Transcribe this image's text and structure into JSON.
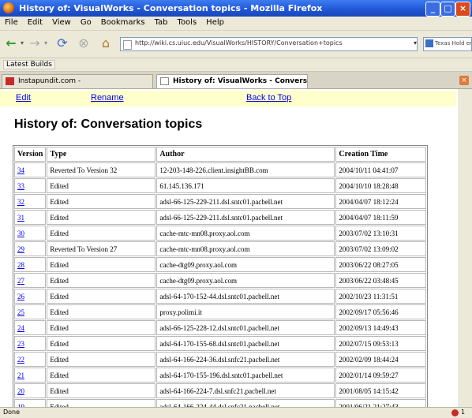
{
  "window": {
    "title": "History of: VisualWorks - Conversation topics - Mozilla Firefox",
    "minimize": "_",
    "maximize": "□",
    "close": "×"
  },
  "menu": [
    "File",
    "Edit",
    "View",
    "Go",
    "Bookmarks",
    "Tab",
    "Tools",
    "Help"
  ],
  "nav": {
    "back_icon": "←",
    "dropdown_icon": "▾",
    "forward_icon": "→",
    "reload_icon": "⟳",
    "stop_icon": "⊗",
    "home_icon": "⌂",
    "url": "http://wiki.cs.uiuc.edu/VisualWorks/HISTORY/Conversation+topics",
    "search_text": "Texas Hold em"
  },
  "bookmarks": {
    "latest_builds": "Latest Builds"
  },
  "tabs": [
    {
      "label": "Instapundit.com -"
    },
    {
      "label": "History of: VisualWorks - Conversatio..."
    }
  ],
  "tab_close": "×",
  "links": {
    "edit": "Edit",
    "rename": "Rename",
    "back_to_top": "Back to Top"
  },
  "page_title": "History of: Conversation topics",
  "table": {
    "headers": [
      "Version",
      "Type",
      "Author",
      "Creation Time"
    ],
    "rows": [
      [
        "34",
        "Reverted To Version 32",
        "12-203-148-226.client.insightBB.com",
        "2004/10/11 04:41:07"
      ],
      [
        "33",
        "Edited",
        "61.145.136.171",
        "2004/10/10 18:28:48"
      ],
      [
        "32",
        "Edited",
        "adsl-66-125-229-211.dsl.sntc01.pacbell.net",
        "2004/04/07 18:12:24"
      ],
      [
        "31",
        "Edited",
        "adsl-66-125-229-211.dsl.sntc01.pacbell.net",
        "2004/04/07 18:11:59"
      ],
      [
        "30",
        "Edited",
        "cache-mtc-mn08.proxy.aol.com",
        "2003/07/02 13:10:31"
      ],
      [
        "29",
        "Reverted To Version 27",
        "cache-mtc-mn08.proxy.aol.com",
        "2003/07/02 13:09:02"
      ],
      [
        "28",
        "Edited",
        "cache-dtg09.proxy.aol.com",
        "2003/06/22 08:27:05"
      ],
      [
        "27",
        "Edited",
        "cache-dtg09.proxy.aol.com",
        "2003/06/22 03:48:45"
      ],
      [
        "26",
        "Edited",
        "adsl-64-170-152-44.dsl.sntc01.pacbell.net",
        "2002/10/23 11:31:51"
      ],
      [
        "25",
        "Edited",
        "proxy.polimi.it",
        "2002/09/17 05:56:46"
      ],
      [
        "24",
        "Edited",
        "adsl-66-125-228-12.dsl.sntc01.pacbell.net",
        "2002/09/13 14:49:43"
      ],
      [
        "23",
        "Edited",
        "adsl-64-170-155-68.dsl.sntc01.pacbell.net",
        "2002/07/15 09:53:13"
      ],
      [
        "22",
        "Edited",
        "adsl-64-166-224-36.dsl.snfc21.pacbell.net",
        "2002/02/09 18:44:24"
      ],
      [
        "21",
        "Edited",
        "adsl-64-170-155-196.dsl.sntc01.pacbell.net",
        "2002/01/14 09:59:27"
      ],
      [
        "20",
        "Edited",
        "adsl-64-166-224-7.dsl.snfc21.pacbell.net",
        "2001/08/05 14:15:42"
      ],
      [
        "19",
        "Edited",
        "adsl-64-166-224-44.dsl.snfc21.pacbell.net",
        "2001/06/21 21:27:43"
      ]
    ]
  },
  "status": {
    "text": "Done",
    "count": "1"
  }
}
